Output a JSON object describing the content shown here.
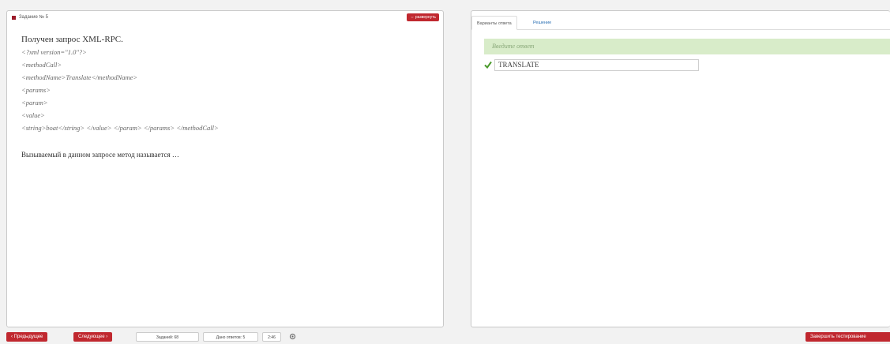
{
  "task": {
    "header": "Задание № 5",
    "expand_label": "⇔ развернуть"
  },
  "question": {
    "heading": "Получен запрос XML-RPC.",
    "code_lines": [
      "<?xml version=\"1.0\"?>",
      "<methodCall>",
      "<methodName>Translate</methodName>",
      "<params>",
      "<param>",
      "<value>",
      "<string>boat</string> </value> </param> </params> </methodCall>"
    ],
    "prompt": "Вызываемый в данном запросе метод называется …"
  },
  "right": {
    "tabs": [
      "Варианты ответа",
      "Решение"
    ],
    "hint": "Введите ответ",
    "answer_value": "TRANSLATE",
    "check_icon": "check-icon"
  },
  "footer": {
    "prev_label": "‹ Предыдущее",
    "next_label": "Следующее ›",
    "tasks_count": "Заданий: 68",
    "answered_count": "Дано ответов: 5",
    "timer": "2:46",
    "settings_icon": "gear-icon",
    "finish_label": "Завершить тестирование"
  },
  "colors": {
    "accent_red": "#c0282f",
    "hint_green": "#d8ecc9",
    "check_green": "#4a9a2c",
    "link_blue": "#2a6fb3"
  }
}
